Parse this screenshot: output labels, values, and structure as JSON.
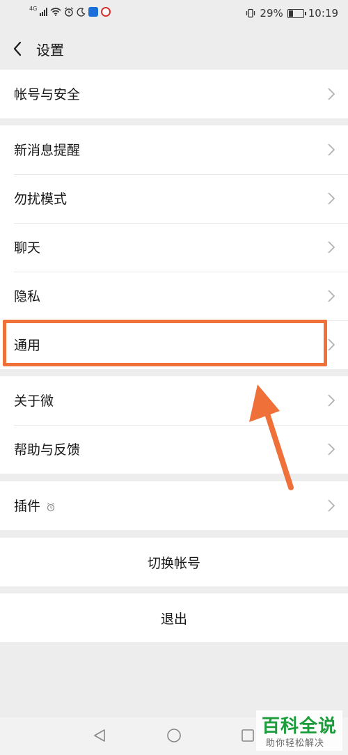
{
  "status_bar": {
    "network": "4G",
    "battery_percent": "29%",
    "battery_level": 0.29,
    "time": "10:19"
  },
  "header": {
    "title": "设置"
  },
  "groups": [
    {
      "items": [
        {
          "label": "帐号与安全"
        }
      ]
    },
    {
      "items": [
        {
          "label": "新消息提醒"
        },
        {
          "label": "勿扰模式"
        },
        {
          "label": "聊天"
        },
        {
          "label": "隐私"
        },
        {
          "label": "通用"
        }
      ]
    },
    {
      "items": [
        {
          "label": "关于微"
        },
        {
          "label": "帮助与反馈"
        }
      ]
    },
    {
      "items": [
        {
          "label": "插件"
        }
      ]
    }
  ],
  "actions": {
    "switch_account": "切换帐号",
    "logout": "退出"
  },
  "watermark": {
    "title": "百科全说",
    "subtitle": "助你轻松解决"
  },
  "annotation": {
    "highlight_color": "#f0703a",
    "highlighted_item": "通用"
  },
  "icons": [
    "signal-icon",
    "wifi-icon",
    "alarm-icon",
    "moon-icon",
    "vibrate-icon",
    "battery-icon",
    "back-icon",
    "chevron-right-icon",
    "plugin-icon",
    "nav-back-icon",
    "nav-home-icon",
    "nav-recent-icon"
  ]
}
